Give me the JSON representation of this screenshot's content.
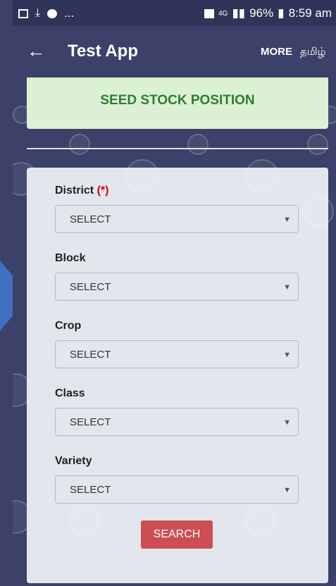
{
  "status_bar": {
    "left_icons": [
      "image-icon",
      "download-icon",
      "record-icon"
    ],
    "ellipsis": "...",
    "sim": "1",
    "network": "4G",
    "battery": "96%",
    "time": "8:59 am"
  },
  "app_bar": {
    "back": "←",
    "title": "Test App",
    "more": "MORE",
    "language": "தமிழ்"
  },
  "header": {
    "title": "SEED STOCK POSITION"
  },
  "form": {
    "required_mark": "(*)",
    "fields": [
      {
        "label": "District",
        "value": "SELECT"
      },
      {
        "label": "Block",
        "value": "SELECT"
      },
      {
        "label": "Crop",
        "value": "SELECT"
      },
      {
        "label": "Class",
        "value": "SELECT"
      },
      {
        "label": "Variety",
        "value": "SELECT"
      }
    ],
    "search_label": "SEARCH"
  },
  "colors": {
    "background": "#3b4168",
    "header_bg": "#dcf1d4",
    "header_text": "#2e7d32",
    "button": "#cc4e55",
    "required": "#d50000"
  }
}
